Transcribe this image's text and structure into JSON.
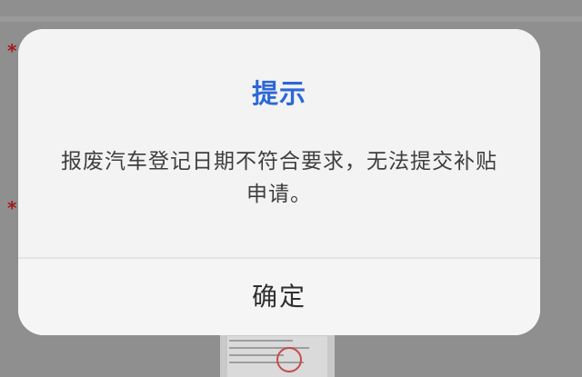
{
  "background": {
    "required_marks": [
      "*",
      "*"
    ]
  },
  "dialog": {
    "title": "提示",
    "message": "报废汽车登记日期不符合要求，无法提交补贴申请。",
    "confirm_label": "确定"
  },
  "colors": {
    "title": "#2d67d6",
    "text": "#3e3e3e",
    "dialog_bg": "#f4f4f4",
    "overlay": "#8f8f8f",
    "required_mark": "#a11b1b"
  }
}
